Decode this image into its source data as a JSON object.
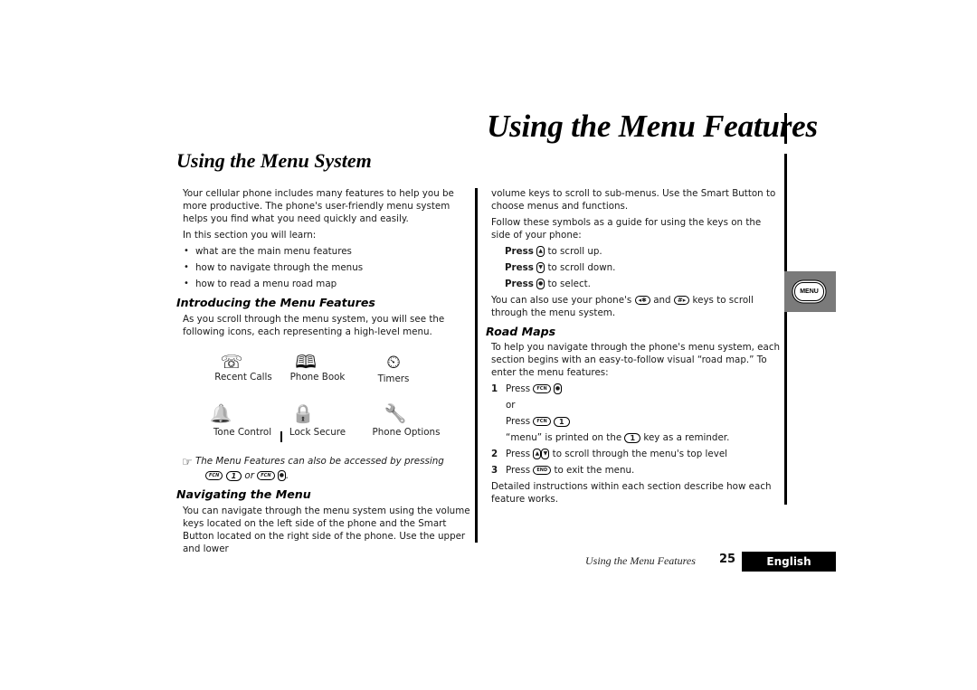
{
  "header": {
    "page_title": "Using the Menu Features",
    "section_title": "Using the Menu System"
  },
  "left": {
    "intro": "Your cellular phone includes many features to help you be more productive. The phone's user-friendly menu system helps you find what you need quickly and easily.",
    "learn_lead": "In this section you will learn:",
    "bullets": [
      "what are the main menu features",
      "how to navigate through the menus",
      "how to read a menu road map"
    ],
    "intro_features": {
      "heading": "Introducing the Menu Features",
      "text": "As you scroll through the menu system, you will see the following icons, each representing a high-level menu.",
      "icons": [
        {
          "label": "Recent Calls",
          "icon": "telephone-icon",
          "glyph": "☏"
        },
        {
          "label": "Phone Book",
          "icon": "book-icon",
          "glyph": "🕮"
        },
        {
          "label": "Timers",
          "icon": "clock-icon",
          "glyph": "⏲"
        },
        {
          "label": "Tone Control",
          "icon": "bell-icon",
          "glyph": "🔔"
        },
        {
          "label": "Lock Secure",
          "icon": "lock-icon",
          "glyph": "🔒"
        },
        {
          "label": "Phone Options",
          "icon": "wrench-icon",
          "glyph": "🔧"
        }
      ],
      "note_text": "The Menu Features can also be accessed by pressing",
      "note_or": "or",
      "note_end": "."
    },
    "navigating": {
      "heading": "Navigating the Menu",
      "text": "You can navigate through the menu system using the volume keys located on the left side of the phone and the Smart Button located on the right side of the phone. Use the upper and lower"
    }
  },
  "right": {
    "continued": "volume keys to scroll to sub-menus. Use the Smart Button to choose menus and functions.",
    "follow": "Follow these symbols as a guide for using the keys on the side of your phone:",
    "press_items": [
      {
        "press": "Press",
        "key": "▲",
        "text": "to scroll up."
      },
      {
        "press": "Press",
        "key": "▼",
        "text": "to scroll down."
      },
      {
        "press": "Press",
        "key": "●",
        "text": "to select."
      }
    ],
    "also_a": "You can also use your phone's",
    "also_key1": "◂✱",
    "also_and": "and",
    "also_key2": "#▸",
    "also_b": "keys to scroll through the menu system.",
    "road_maps": {
      "heading": "Road Maps",
      "text": "To help you navigate through the phone's menu system, each section begins with an easy-to-follow visual “road map.” To enter the menu features:",
      "steps": [
        {
          "num": "1",
          "press": "Press",
          "or": "or",
          "press2": "Press",
          "reminder_a": "“menu” is printed on the",
          "reminder_b": "key as a reminder."
        },
        {
          "num": "2",
          "press": "Press",
          "text": "to scroll through the menu's top level"
        },
        {
          "num": "3",
          "press": "Press",
          "text": "to exit the menu."
        }
      ],
      "closing": "Detailed instructions within each section describe how each feature works."
    }
  },
  "keys": {
    "fcn": "FCN",
    "one": "1",
    "end": "END",
    "smart": "●"
  },
  "tab": {
    "label": "MENU"
  },
  "footer": {
    "running_title": "Using the Menu Features",
    "page_number": "25",
    "language": "English"
  }
}
